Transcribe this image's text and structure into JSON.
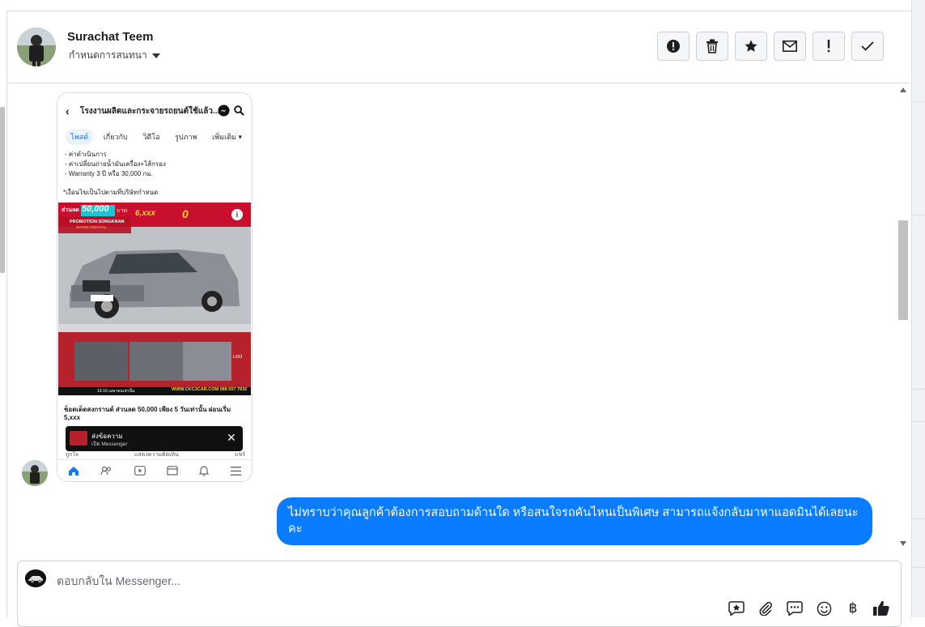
{
  "header": {
    "name": "Surachat Teem",
    "assign_label": "กำหนดการสนทนา",
    "toolbar": [
      {
        "icon": "alert-circle-icon"
      },
      {
        "icon": "trash-icon"
      },
      {
        "icon": "star-icon"
      },
      {
        "icon": "envelope-icon"
      },
      {
        "icon": "exclamation-icon"
      },
      {
        "icon": "check-icon"
      }
    ]
  },
  "shared_screenshot": {
    "title": "โรงงานผลิตและกระจายรถยนต์ใช้แล้ว...",
    "tabs": [
      "โพสต์",
      "เกี่ยวกับ",
      "วิดีโอ",
      "รูปภาพ",
      "เพิ่มเติม ▾"
    ],
    "lines": [
      "- ค่าดำเนินการ",
      "- ค่าเปลี่ยนถ่ายน้ำมันเครื่อง+ไส้กรอง",
      "- Warranty 3 ปี หรือ 30,000 กม."
    ],
    "condition": "*เงื่อนไขเป็นไปตามที่บริษัทกำหนด",
    "promo": {
      "discount_label": "ส่วนลด",
      "discount": "50,000",
      "discount_unit": "บาท",
      "installment": "6,xxx",
      "down": "0",
      "banner": "PROMOTION SONGKRAN",
      "banner_sub": "WATER FESTIVAL",
      "footer_left": "13-16 เมษายนเท่านั้น",
      "footer_right": "WWW.CKC2CAR.COM 088 557 7932",
      "code": "L033"
    },
    "caption": "ช็อตเด็ดสงกรานต์ ส่วนลด 50,000 เพียง 5 วันเท่านั้น ผ่อนเริ่ม 5,xxx",
    "toast_title": "ส่งข้อความ",
    "toast_sub": "เปิด Messenger",
    "action_like": "ถูกใจ",
    "action_comment": "แสดงความคิดเห็น",
    "action_share": "แชร์"
  },
  "outgoing_message": "ไม่ทราบว่าคุณลูกค้าต้องการสอบถามด้านใด หรือสนใจรถคันไหนเป็นพิเศษ สามารถแจ้งกลับมาหาแอดมินได้เลยนะคะ",
  "composer": {
    "placeholder": "ตอบกลับใน Messenger...",
    "icons": [
      "saved-reply-icon",
      "attachment-icon",
      "chat-bubbles-icon",
      "emoji-icon",
      "baht-icon",
      "thumbs-up-icon"
    ]
  },
  "colors": {
    "bubble": "#0a7cff",
    "border": "#dadde1"
  }
}
